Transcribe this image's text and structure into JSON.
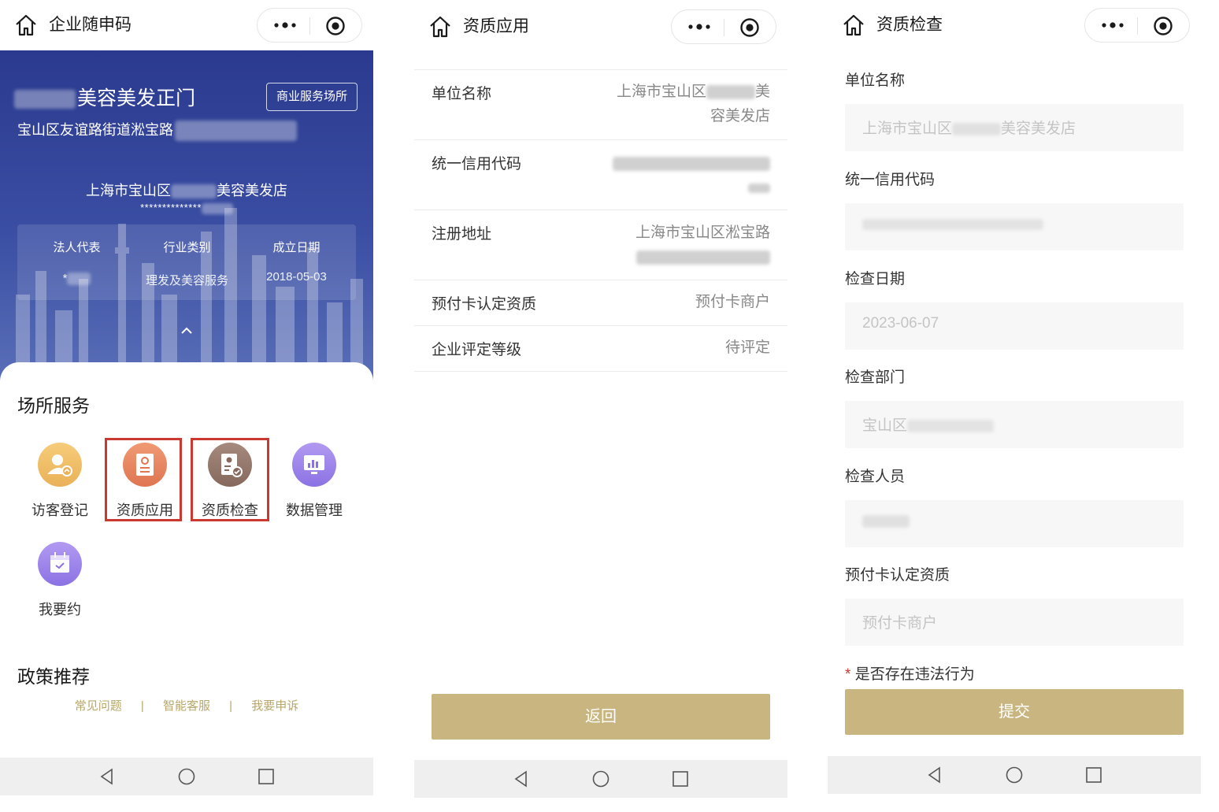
{
  "colors": {
    "accent_gold": "#c8b57f",
    "hero_blue": "#3347a0",
    "highlight_red": "#c9392f"
  },
  "screen1": {
    "title": "企业随申码",
    "shop_name": "美容美发正门",
    "shop_tag": "商业服务场所",
    "shop_address": "宝山区友谊路街道淞宝路",
    "registered_name_prefix": "上海市宝山区",
    "registered_name_suffix": "美容美发店",
    "registered_code": "**************",
    "info": {
      "legal_rep_label": "法人代表",
      "legal_rep_value": "*",
      "industry_label": "行业类别",
      "industry_value": "理发及美容服务",
      "date_label": "成立日期",
      "date_value": "2018-05-03"
    },
    "services_title": "场所服务",
    "services": [
      {
        "label": "访客登记",
        "icon": "visitor-icon"
      },
      {
        "label": "资质应用",
        "icon": "certificate-icon"
      },
      {
        "label": "资质检查",
        "icon": "inspection-icon"
      },
      {
        "label": "数据管理",
        "icon": "data-chart-icon"
      },
      {
        "label": "我要约",
        "icon": "calendar-icon"
      }
    ],
    "policy_title": "政策推荐",
    "policy_links": [
      "常见问题",
      "|",
      "智能客服",
      "|",
      "我要申诉"
    ]
  },
  "screen2": {
    "title": "资质应用",
    "rows": [
      {
        "label": "单位名称",
        "value_line1": "上海市宝山区",
        "value_line1_tail": "美",
        "value_line2": "容美发店"
      },
      {
        "label": "统一信用代码"
      },
      {
        "label": "注册地址",
        "value_line1": "上海市宝山区淞宝路"
      },
      {
        "label": "预付卡认定资质",
        "value_line1": "预付卡商户"
      },
      {
        "label": "企业评定等级",
        "value_line1": "待评定"
      }
    ],
    "back_button": "返回"
  },
  "screen3": {
    "title": "资质检查",
    "fields": [
      {
        "label": "单位名称",
        "value_prefix": "上海市宝山区",
        "value_suffix": "美容美发店"
      },
      {
        "label": "统一信用代码",
        "value_prefix": ""
      },
      {
        "label": "检查日期",
        "value_prefix": "2023-06-07"
      },
      {
        "label": "检查部门",
        "value_prefix": "宝山区"
      },
      {
        "label": "检查人员",
        "value_prefix": ""
      },
      {
        "label": "预付卡认定资质",
        "value_prefix": "预付卡商户"
      }
    ],
    "required_mark": "*",
    "violation_label": "是否存在违法行为",
    "submit_button": "提交"
  }
}
